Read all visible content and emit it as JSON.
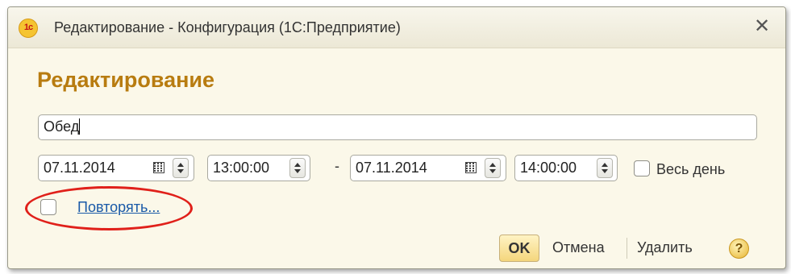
{
  "window": {
    "title": "Редактирование - Конфигурация  (1С:Предприятие)",
    "logo_text": "1c",
    "close_glyph": "✕"
  },
  "form": {
    "heading": "Редактирование",
    "description": "Обед",
    "start_date": "07.11.2014",
    "start_time": "13:00:00",
    "range_separator": "-",
    "end_date": "07.11.2014",
    "end_time": "14:00:00",
    "all_day_label": "Весь день",
    "all_day_checked": false,
    "repeat_label": "Повторять...",
    "repeat_checked": false
  },
  "buttons": {
    "ok": "OK",
    "cancel": "Отмена",
    "delete": "Удалить",
    "help": "?"
  },
  "colors": {
    "heading": "#b87c10",
    "window_bg": "#fbf8e9",
    "link": "#1a5aa8",
    "highlight_ellipse": "#e0201a"
  },
  "icons": {
    "calendar": "calendar-icon",
    "spinner": "spinner-updown-icon",
    "help": "help-icon",
    "close": "close-icon",
    "logo": "1c-logo-icon"
  }
}
